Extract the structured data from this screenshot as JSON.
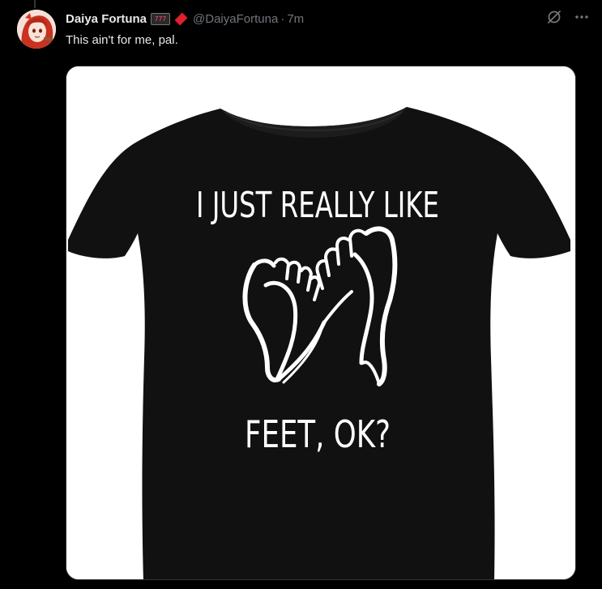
{
  "post": {
    "display_name": "Daiya Fortuna",
    "badge_icon": "slot-machine-777-icon",
    "badge_text": "777",
    "diamond_icon": "red-diamond-icon",
    "diamond_color": "#e0202c",
    "handle": "@DaiyaFortuna",
    "separator": "·",
    "time": "7m",
    "text": "This ain't for me, pal."
  },
  "actions": {
    "grok_icon": "grok-icon",
    "more_icon": "more-icon"
  },
  "media": {
    "shirt_line1": "I JUST REALLY LIKE",
    "shirt_line2": "FEET, OK?",
    "shirt_color": "#111111",
    "background": "#ffffff"
  },
  "colors": {
    "background": "#000000",
    "primary_text": "#e7e9ea",
    "secondary_text": "#71767b"
  }
}
